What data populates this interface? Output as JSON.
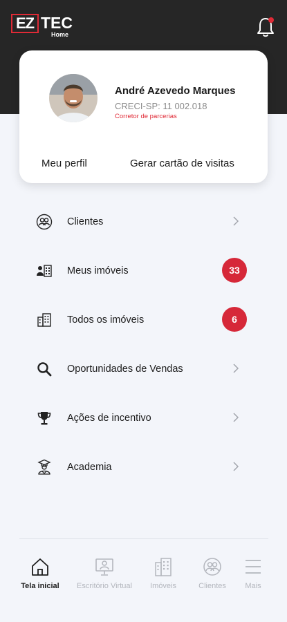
{
  "brand": {
    "logo_ez": "EZ",
    "logo_tec": "TEC",
    "logo_home": "Home",
    "accent": "#e02a36"
  },
  "header": {
    "notification_icon": "bell-icon"
  },
  "profile": {
    "name": "André Azevedo Marques",
    "creci": "CRECI-SP: 11 002.018",
    "role": "Corretor de parcerias",
    "link_profile": "Meu perfil",
    "link_card": "Gerar cartão de visitas"
  },
  "menu": {
    "items": [
      {
        "label": "Clientes",
        "icon": "people-icon"
      },
      {
        "label": "Meus imóveis",
        "icon": "user-building-icon",
        "badge": "33"
      },
      {
        "label": "Todos os imóveis",
        "icon": "buildings-icon",
        "badge": "6"
      },
      {
        "label": "Oportunidades de Vendas",
        "icon": "search-icon"
      },
      {
        "label": "Ações de incentivo",
        "icon": "trophy-icon"
      },
      {
        "label": "Academia",
        "icon": "graduation-icon"
      }
    ]
  },
  "tabbar": {
    "tabs": [
      {
        "label": "Tela inicial",
        "icon": "home-icon",
        "active": true
      },
      {
        "label": "Escritório Virtual",
        "icon": "monitor-user-icon"
      },
      {
        "label": "Imóveis",
        "icon": "building-icon"
      },
      {
        "label": "Clientes",
        "icon": "people-icon"
      },
      {
        "label": "Mais",
        "icon": "menu-icon"
      }
    ]
  }
}
